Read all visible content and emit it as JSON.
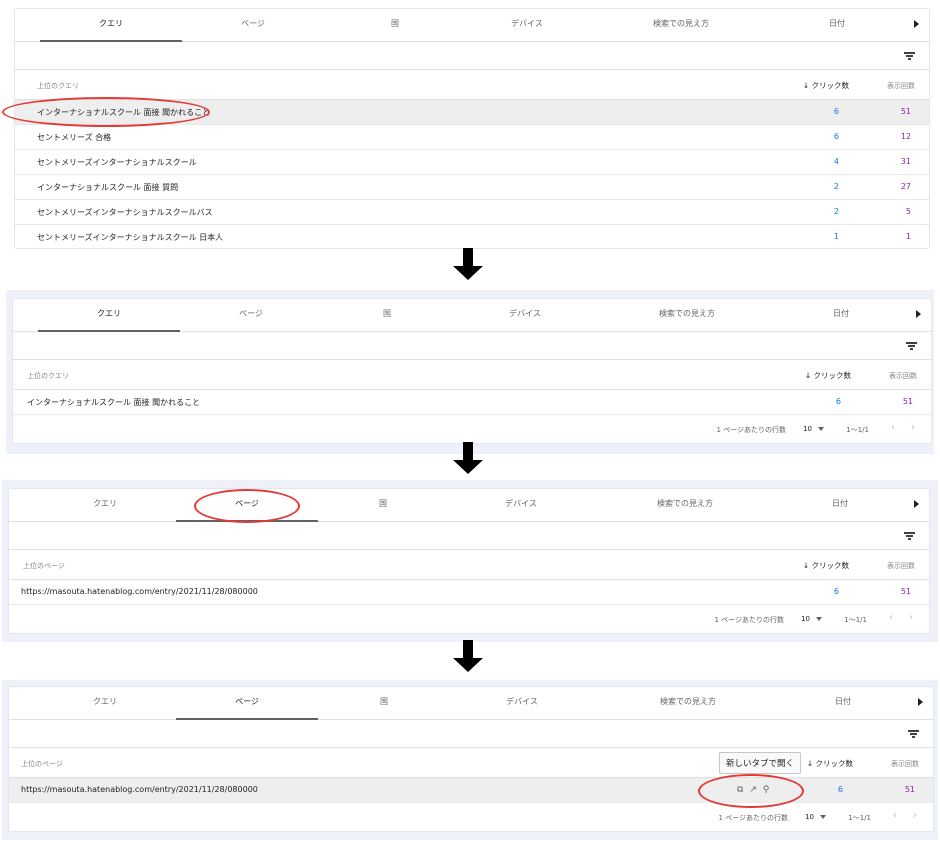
{
  "tabs": [
    "クエリ",
    "ページ",
    "国",
    "デバイス",
    "検索での見え方",
    "日付"
  ],
  "filter_icon": "filter-icon",
  "columns": {
    "top_queries": "上位のクエリ",
    "top_pages": "上位のページ",
    "clicks": "クリック数",
    "impressions": "表示回数",
    "clicks_sort_icon": "arrow-down-icon"
  },
  "panel1": {
    "active_tab": "クエリ",
    "rows": [
      {
        "label": "インターナショナルスクール 面接 聞かれること",
        "clicks": "6",
        "impressions": "51"
      },
      {
        "label": "セントメリーズ 合格",
        "clicks": "6",
        "impressions": "12"
      },
      {
        "label": "セントメリーズインターナショナルスクール",
        "clicks": "4",
        "impressions": "31"
      },
      {
        "label": "インターナショナルスクール 面接 質問",
        "clicks": "2",
        "impressions": "27"
      },
      {
        "label": "セントメリーズインターナショナルスクールバス",
        "clicks": "2",
        "impressions": "5"
      },
      {
        "label": "セントメリーズインターナショナルスクール 日本人",
        "clicks": "1",
        "impressions": "1"
      }
    ]
  },
  "panel2": {
    "active_tab": "クエリ",
    "rows": [
      {
        "label": "インターナショナルスクール 面接 聞かれること",
        "clicks": "6",
        "impressions": "51"
      }
    ]
  },
  "panel3": {
    "active_tab": "ページ",
    "rows": [
      {
        "label": "https://masouta.hatenablog.com/entry/2021/11/28/080000",
        "clicks": "6",
        "impressions": "51"
      }
    ]
  },
  "panel4": {
    "active_tab": "ページ",
    "rows": [
      {
        "label": "https://masouta.hatenablog.com/entry/2021/11/28/080000",
        "clicks": "6",
        "impressions": "51"
      }
    ],
    "tooltip": "新しいタブで開く",
    "row_icons": [
      "copy-icon",
      "open-in-new-icon",
      "search-icon"
    ]
  },
  "pager": {
    "rows_per_page_label": "1 ページあたりの行数",
    "rows_per_page_value": "10",
    "range": "1〜1/1"
  },
  "annotation_color": "#e53935"
}
